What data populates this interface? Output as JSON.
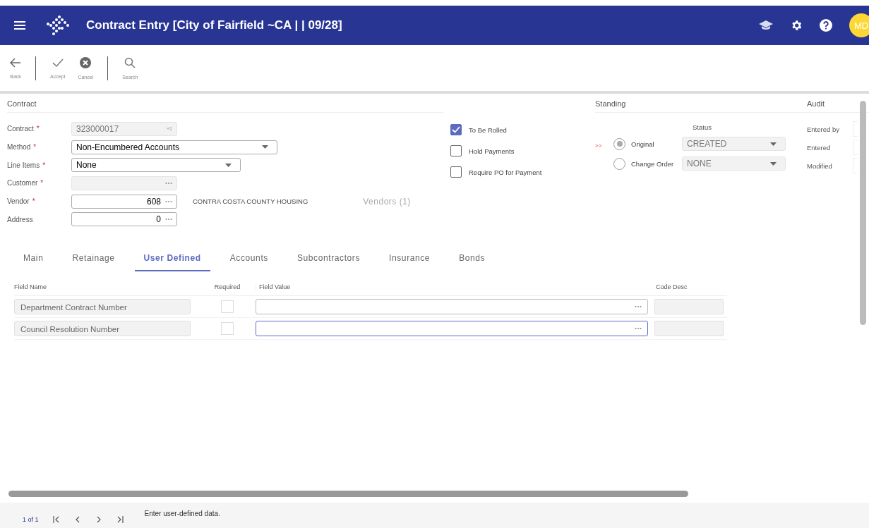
{
  "header": {
    "title": "Contract Entry [City of Fairfield ~CA | | 09/28]",
    "avatar": "MD"
  },
  "toolbar": [
    [
      {
        "label": "Back",
        "kind": "back"
      }
    ],
    [
      {
        "label": "Accept",
        "kind": "accept"
      },
      {
        "label": "Cancel",
        "kind": "cancel"
      }
    ],
    [
      {
        "label": "Search",
        "kind": "search"
      }
    ]
  ],
  "contract": {
    "heading": "Contract",
    "fields": [
      {
        "label": "Contract",
        "required_mark": "*",
        "kind": "text",
        "value": "323000017",
        "suffix": "+1",
        "disabled": true
      },
      {
        "label": "Method",
        "required_mark": "*",
        "kind": "select",
        "value": "Non-Encumbered Accounts",
        "disabled": false
      },
      {
        "label": "Line Items",
        "required_mark": "*",
        "kind": "select",
        "value": "None",
        "disabled": false
      },
      {
        "label": "Customer",
        "required_mark": "*",
        "kind": "lookup",
        "disabled": true
      },
      {
        "label": "Vendor",
        "required_mark": "*",
        "kind": "lookup",
        "value": "608",
        "disabled": false
      },
      {
        "label": "Address",
        "kind": "lookup",
        "value": "0",
        "disabled": false
      }
    ],
    "vendor_name": "CONTRA COSTA COUNTY HOUSING",
    "vendors_link": "Vendors (1)"
  },
  "options": [
    {
      "label": "To Be Rolled",
      "checked": true
    },
    {
      "label": "Hold Payments",
      "checked": false
    },
    {
      "label": "Require PO for Payment",
      "checked": false
    }
  ],
  "standing": {
    "heading": "Standing",
    "status_label": "Status",
    "rows": [
      {
        "marker": ">>",
        "label": "Original",
        "selected": true,
        "status": "CREATED"
      },
      {
        "label": "Change Order",
        "selected": false,
        "status": "NONE"
      }
    ]
  },
  "audit": {
    "heading": "Audit",
    "fields": [
      "Entered by",
      "Entered",
      "Modified"
    ]
  },
  "tabs": [
    {
      "label": "Main",
      "selected": false
    },
    {
      "label": "Retainage",
      "selected": false
    },
    {
      "label": "User Defined",
      "selected": true
    },
    {
      "label": "Accounts",
      "selected": false
    },
    {
      "label": "Subcontractors",
      "selected": false
    },
    {
      "label": "Insurance",
      "selected": false
    },
    {
      "label": "Bonds",
      "selected": false
    }
  ],
  "grid": {
    "columns": [
      "Field Name",
      "Required",
      "Field Value",
      "Code Desc"
    ],
    "rows": [
      {
        "field_name": "Department Contract Number",
        "required": false,
        "focused": false
      },
      {
        "field_name": "Council Resolution Number",
        "required": false,
        "focused": true
      }
    ]
  },
  "status_bar": {
    "page": "1 of 1",
    "message": "Enter user-defined data."
  }
}
